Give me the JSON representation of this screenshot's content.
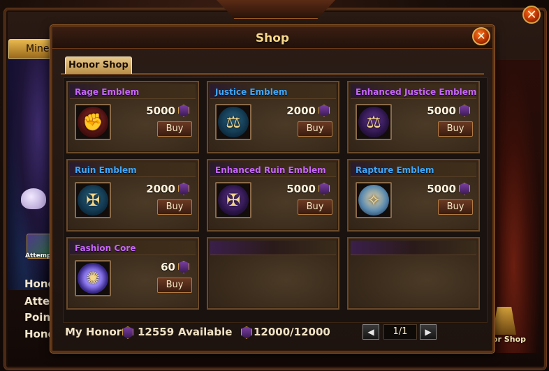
{
  "background": {
    "tab_label": "Mine",
    "labels": [
      "Hono",
      "Atter",
      "Poin",
      "Hono"
    ],
    "attempt_label": "Attemp",
    "honor_shop_label": "or Shop",
    "close_glyph": "✕"
  },
  "shop": {
    "title": "Shop",
    "close_glyph": "✕",
    "tabs": [
      {
        "label": "Honor Shop",
        "active": true
      }
    ],
    "items": [
      {
        "name": "Rage Emblem",
        "price": "5000",
        "buy_label": "Buy",
        "name_color": "#c866ff",
        "icon": "rage-emblem-icon",
        "glyph": "✊",
        "icon_bg": "radial-gradient(circle at 50% 45%, #b03a3a, #4a1010 60%, #1a0606)"
      },
      {
        "name": "Justice Emblem",
        "price": "2000",
        "buy_label": "Buy",
        "name_color": "#3ea8ff",
        "icon": "justice-emblem-icon",
        "glyph": "⚖",
        "icon_bg": "radial-gradient(circle at 50% 45%, #2e6a8a, #10344a 60%, #061420)"
      },
      {
        "name": "Enhanced Justice Emblem",
        "price": "5000",
        "buy_label": "Buy",
        "name_color": "#c866ff",
        "icon": "enhanced-justice-emblem-icon",
        "glyph": "⚖",
        "icon_bg": "radial-gradient(circle at 50% 45%, #6a3a9a, #2a1446 60%, #100618)"
      },
      {
        "name": "Ruin Emblem",
        "price": "2000",
        "buy_label": "Buy",
        "name_color": "#3ea8ff",
        "icon": "ruin-emblem-icon",
        "glyph": "✠",
        "icon_bg": "radial-gradient(circle at 50% 45%, #2e6a8a, #10344a 60%, #061420)"
      },
      {
        "name": "Enhanced Ruin Emblem",
        "price": "5000",
        "buy_label": "Buy",
        "name_color": "#c866ff",
        "icon": "enhanced-ruin-emblem-icon",
        "glyph": "✠",
        "icon_bg": "radial-gradient(circle at 50% 45%, #6a3a9a, #2a1446 60%, #100618)"
      },
      {
        "name": "Rapture Emblem",
        "price": "5000",
        "buy_label": "Buy",
        "name_color": "#3ea8ff",
        "icon": "rapture-emblem-icon",
        "glyph": "✧",
        "icon_bg": "radial-gradient(circle at 50% 45%, #f0d6a0, #5a8ab0 55%, #14243a)"
      },
      {
        "name": "Fashion Core",
        "price": "60",
        "buy_label": "Buy",
        "name_color": "#c866ff",
        "icon": "fashion-core-icon",
        "glyph": "✺",
        "icon_bg": "radial-gradient(circle at 50% 50%, #ffffff, #9a86ff 35%, #3a2a8a 65%, #0a0820)"
      }
    ],
    "empty_slots": 2,
    "footer": {
      "my_honor_label": "My Honor",
      "my_honor_value": "12559",
      "available_label": "Available",
      "available_value": "12000/12000",
      "page": "1/1",
      "prev_glyph": "◀",
      "next_glyph": "▶"
    }
  }
}
